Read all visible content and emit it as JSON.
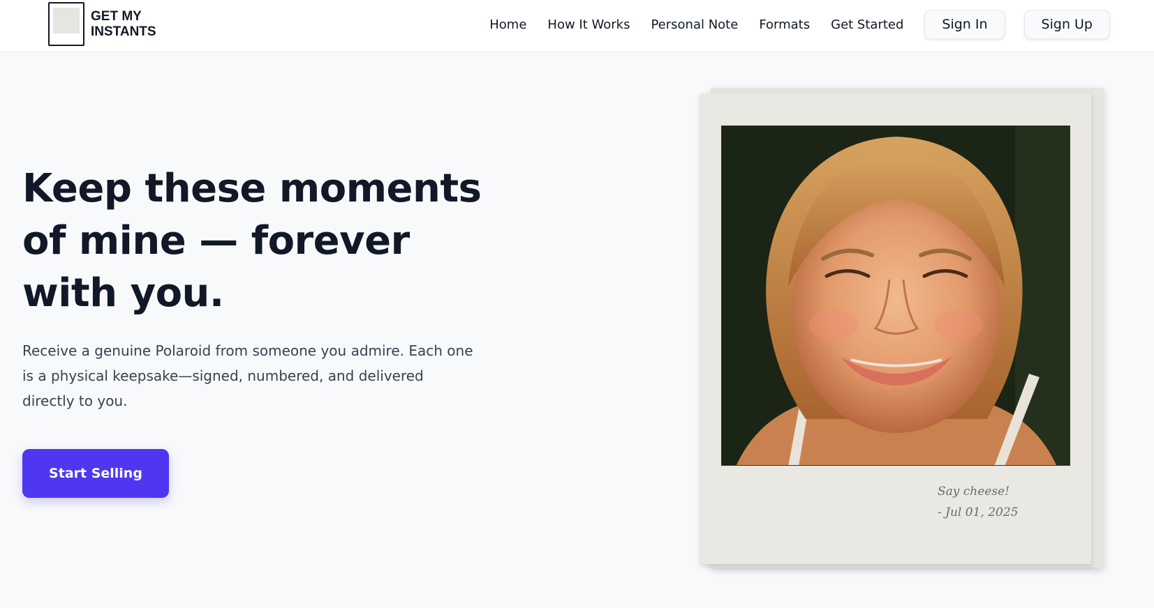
{
  "brand": {
    "name_line1": "GET MY",
    "name_line2": "INSTANTS"
  },
  "nav": {
    "links": [
      "Home",
      "How It Works",
      "Personal Note",
      "Formats",
      "Get Started"
    ],
    "sign_in": "Sign In",
    "sign_up": "Sign Up"
  },
  "hero": {
    "title_line1": "Keep these moments",
    "title_line2": "of mine — forever",
    "title_line3": "with you.",
    "subtitle_line1": "Receive a genuine Polaroid from someone you admire. Each one",
    "subtitle_line2": "is a physical keepsake—signed, numbered, and delivered",
    "subtitle_line3": "directly to you.",
    "cta_label": "Start Selling"
  },
  "polaroid": {
    "caption_line1": "Say cheese!",
    "caption_line2": "- Jul 01, 2025"
  },
  "colors": {
    "accent": "#4f36f0",
    "heading": "#111827",
    "page_background": "#f8f9fb",
    "polaroid_frame": "#e9e8e2"
  }
}
